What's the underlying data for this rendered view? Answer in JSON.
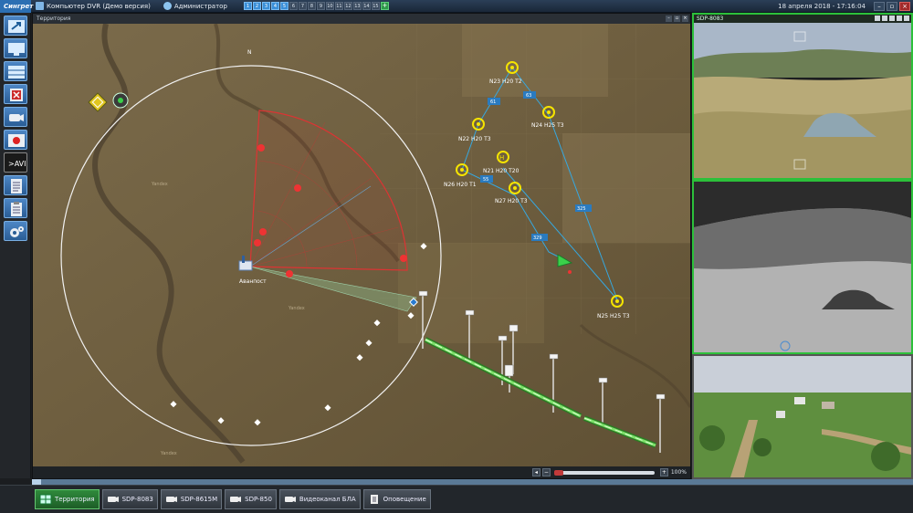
{
  "topbar": {
    "logo": "Сингрет",
    "computer": "Компьютер DVR (Демо версия)",
    "user": "Администратор",
    "workspaces": [
      "1",
      "2",
      "3",
      "4",
      "5",
      "6",
      "7",
      "8",
      "9",
      "10",
      "11",
      "12",
      "13",
      "14",
      "15"
    ],
    "active_workspaces": [
      1,
      2,
      3,
      4
    ],
    "add_label": "+",
    "datetime": "18 апреля 2018 - 17:16:04"
  },
  "map_panel": {
    "title": "Территория",
    "zoom": "100%",
    "labels": {
      "north": "N",
      "avangpost": "Аванпост",
      "t1": "N23 H20 T2",
      "t2": "N24 H25 T3",
      "t3": "N22 H20 T3",
      "t4": "N21 H20 T20",
      "t5": "N26 H20 T1",
      "t6": "N27 H20 T3",
      "t7": "N25 H25 T3",
      "d1": "61",
      "d2": "63",
      "d3": "55",
      "d4": "325",
      "d5": "329",
      "terrain1": "Yandex",
      "terrain2": "Yandex",
      "terrain3": "Yandex"
    }
  },
  "cameras": [
    {
      "title": "SDP-8083"
    },
    {
      "title": ""
    },
    {
      "title": ""
    }
  ],
  "taskbar": [
    {
      "label": "Территория",
      "active": true
    },
    {
      "label": "SDP-8083",
      "active": false
    },
    {
      "label": "SDP-8615M",
      "active": false
    },
    {
      "label": "SDP-850",
      "active": false
    },
    {
      "label": "Видеоканал БЛА",
      "active": false
    },
    {
      "label": "Оповещение",
      "active": false
    }
  ],
  "colors": {
    "accent": "#3b8fd8",
    "active_green": "#2cc03a",
    "radar_red": "#e03030",
    "track_yellow": "#f5e400",
    "track_line": "#36a8e0"
  }
}
